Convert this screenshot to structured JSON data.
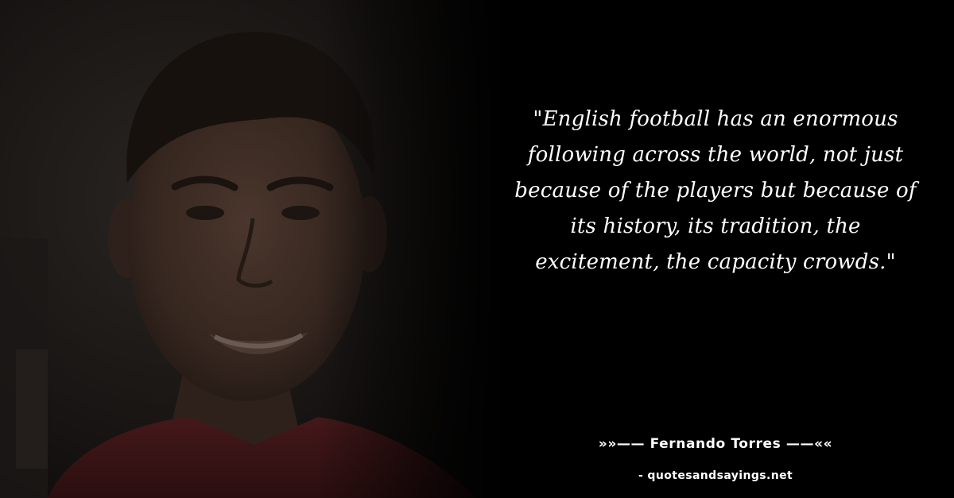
{
  "quote": {
    "text": "\"English football has an enormous following across the world, not just because of the players but because of its history, its tradition, the excitement, the capacity crowds.\""
  },
  "author": {
    "line": "»»—— Fernando Torres ——««"
  },
  "source": {
    "line": "- quotesandsayings.net"
  },
  "photo": {
    "subject": "portrait-photo",
    "colors": {
      "background": "#000000",
      "skin": "#3a2a22",
      "hair": "#1a1410",
      "shirt": "#3b1512"
    }
  }
}
